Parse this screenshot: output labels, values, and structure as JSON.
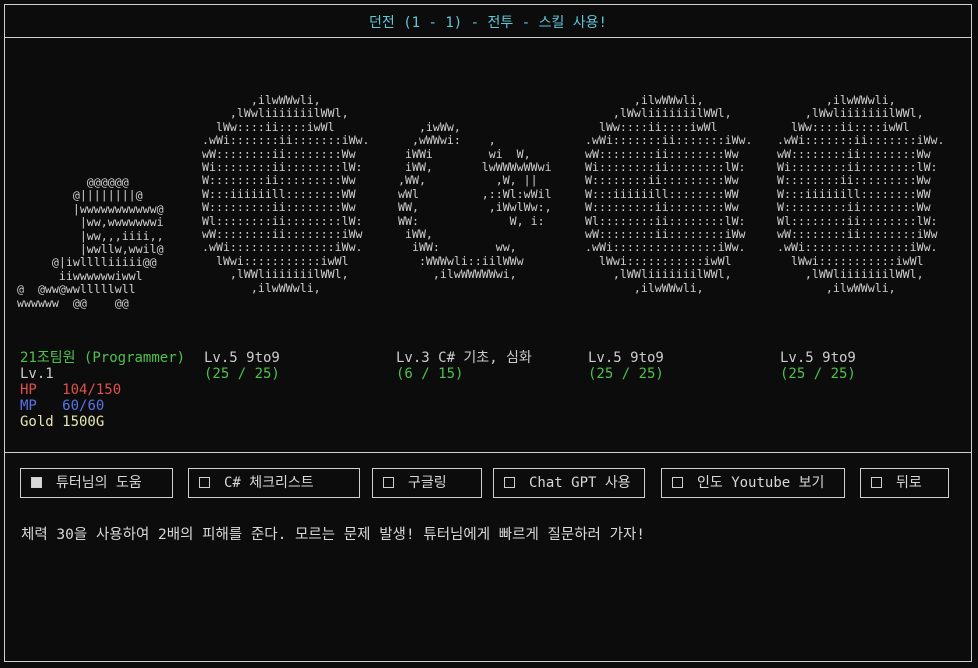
{
  "window": {
    "title": "던전 (1 - 1) - 전투 - 스킬 사용!"
  },
  "colors": {
    "green": "#4ec24e",
    "red": "#e0504c",
    "blue": "#5874e6",
    "cyan": "#5fc8d8",
    "gold": "#e6e6b0"
  },
  "art": {
    "player": "          @@@@@@\n        @||||||||@\n        |wwwwwwwwwww@\n         |ww,wwwwwwwi\n         |ww,,,iiii,,\n         |wwllw,wwil@\n     @|iwlllliiiii@@\n      iiwwwwwwiwwl\n@  @ww@wwlllllwll\nwwwwww  @@    @@",
    "enemy_large": "       ,ilwWWwli,\n    ,lWwliiiiiiilWWl,\n  lWw::::ii::::iwWl\n.wWi:::::::ii:::::::iWw.\nwW::::::::ii::::::::Ww\nWi::::::::ii::::::::lW:\nW::::::::ii:::::::::Ww\nW:::iiiiiill::::::::WW\nW:::::::::ii::::::::Ww\nWl::::::::ii::::::::lW:\nwW::::::::ii::::::::iWw\n.wWi:::::::::::::::iWw.\n  lWwi:::::::::::iwWl\n    ,lWWliiiiiiilWWl,\n       ,ilwWWwli,",
    "enemy_small": "\n\n   ,iwWw,\n  ,wWWwi:    ,\n iWWi        wi  W,\n iWW,       lwWWWwWWwi\n,WW,          ,W, ||\nwWl         ,::Wl:wWil\nWW,          ,iWwlWw:,\nWW:             W, i:\n iWW,\n  iWW:        ww,\n   :WWWwli::iilWWw\n     ,ilwWWWWWwi,"
  },
  "player": {
    "name": "21조팀원 (Programmer)",
    "level": "Lv.1",
    "hp_label": "HP",
    "hp_value": "104/150",
    "mp_label": "MP",
    "mp_value": "60/60",
    "gold": "Gold 1500G"
  },
  "monsters": [
    {
      "name": "Lv.5 9to9",
      "hp": "(25 / 25)"
    },
    {
      "name": "Lv.3 C# 기초, 심화",
      "hp": "(6 / 15)"
    },
    {
      "name": "Lv.5 9to9",
      "hp": "(25 / 25)"
    },
    {
      "name": "Lv.5 9to9",
      "hp": "(25 / 25)"
    }
  ],
  "skills": [
    {
      "label": "튜터님의 도움",
      "checked": true
    },
    {
      "label": "C# 체크리스트",
      "checked": false
    },
    {
      "label": "구글링",
      "checked": false
    },
    {
      "label": "Chat GPT 사용",
      "checked": false
    },
    {
      "label": "인도 Youtube 보기",
      "checked": false
    },
    {
      "label": "뒤로",
      "checked": false
    }
  ],
  "description": "체력 30을 사용하여 2배의 피해를 준다. 모르는 문제 발생! 튜터님에게 빠르게 질문하러 가자!"
}
